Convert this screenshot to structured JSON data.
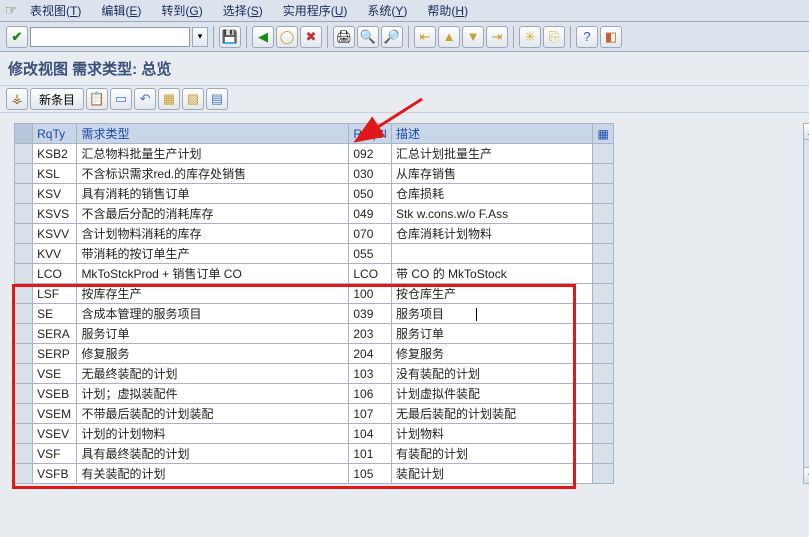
{
  "menu": {
    "items": [
      {
        "label": "表视图(",
        "key": "T",
        "tail": ")"
      },
      {
        "label": "编辑(",
        "key": "E",
        "tail": ")"
      },
      {
        "label": "转到(",
        "key": "G",
        "tail": ")"
      },
      {
        "label": "选择(",
        "key": "S",
        "tail": ")"
      },
      {
        "label": "实用程序(",
        "key": "U",
        "tail": ")"
      },
      {
        "label": "系统(",
        "key": "Y",
        "tail": ")"
      },
      {
        "label": "帮助(",
        "key": "H",
        "tail": ")"
      }
    ]
  },
  "toolbar1_icons": [
    "check",
    "cmd",
    "drop",
    "sep",
    "save",
    "sep",
    "back",
    "exit",
    "cancel",
    "sep",
    "print",
    "find",
    "findnext",
    "sep",
    "first",
    "prev",
    "next",
    "last",
    "sep",
    "newsess",
    "shortcut",
    "sep",
    "help",
    "local"
  ],
  "title": "修改视图 需求类型: 总览",
  "toolbar2": {
    "expand": "⚶",
    "new_entry": "新条目",
    "icons": [
      "copy",
      "delete",
      "undo",
      "select",
      "deselect",
      "config"
    ]
  },
  "table": {
    "headers": {
      "rqty": "RqTy",
      "type": "需求类型",
      "reqcl": "ReqCl",
      "desc": "描述"
    },
    "rows": [
      {
        "rqty": "KSB2",
        "type": "汇总物料批量生产计划",
        "reqcl": "092",
        "desc": "汇总计划批量生产"
      },
      {
        "rqty": "KSL",
        "type": "不含标识需求red.的库存处销售",
        "reqcl": "030",
        "desc": "从库存销售"
      },
      {
        "rqty": "KSV",
        "type": "具有消耗的销售订单",
        "reqcl": "050",
        "desc": "仓库损耗"
      },
      {
        "rqty": "KSVS",
        "type": "不含最后分配的消耗库存",
        "reqcl": "049",
        "desc": "Stk w.cons.w/o F.Ass"
      },
      {
        "rqty": "KSVV",
        "type": "含计划物料消耗的库存",
        "reqcl": "070",
        "desc": "仓库消耗计划物料"
      },
      {
        "rqty": "KVV",
        "type": "带消耗的按订单生产",
        "reqcl": "055",
        "desc": ""
      },
      {
        "rqty": "LCO",
        "type": "MkToStckProd + 销售订单 CO",
        "reqcl": "LCO",
        "desc": "带 CO 的 MkToStock"
      },
      {
        "rqty": "LSF",
        "type": "按库存生产",
        "reqcl": "100",
        "desc": "按仓库生产"
      },
      {
        "rqty": "SE",
        "type": "含成本管理的服务项目",
        "reqcl": "039",
        "desc": "服务项目",
        "cursor": true
      },
      {
        "rqty": "SERA",
        "type": "服务订单",
        "reqcl": "203",
        "desc": "服务订单"
      },
      {
        "rqty": "SERP",
        "type": "修复服务",
        "reqcl": "204",
        "desc": "修复服务"
      },
      {
        "rqty": "VSE",
        "type": "无最终装配的计划",
        "reqcl": "103",
        "desc": "没有装配的计划"
      },
      {
        "rqty": "VSEB",
        "type": "计划；虚拟装配件",
        "reqcl": "106",
        "desc": "计划虚拟件装配"
      },
      {
        "rqty": "VSEM",
        "type": "不带最后装配的计划装配",
        "reqcl": "107",
        "desc": "无最后装配的计划装配"
      },
      {
        "rqty": "VSEV",
        "type": "计划的计划物料",
        "reqcl": "104",
        "desc": "计划物料"
      },
      {
        "rqty": "VSF",
        "type": "具有最终装配的计划",
        "reqcl": "101",
        "desc": "有装配的计划"
      },
      {
        "rqty": "VSFB",
        "type": "有关装配的计划",
        "reqcl": "105",
        "desc": "装配计划"
      }
    ]
  }
}
